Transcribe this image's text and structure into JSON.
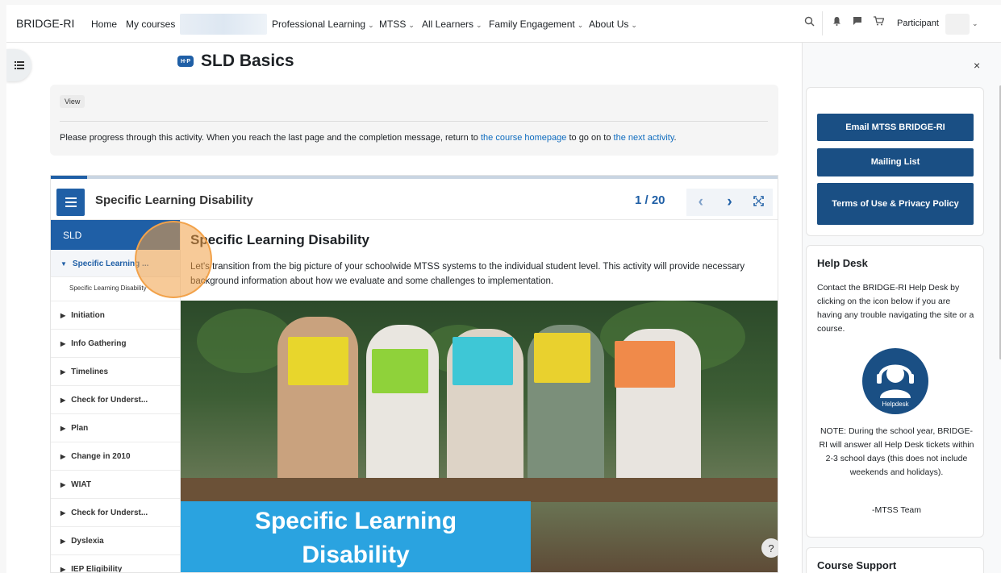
{
  "navbar": {
    "brand": "BRIDGE-RI",
    "links": [
      {
        "label": "Home"
      },
      {
        "label": "My courses"
      },
      {
        "label": "Professional Learning"
      },
      {
        "label": "MTSS"
      },
      {
        "label": "All Learners"
      },
      {
        "label": "Family Engagement"
      },
      {
        "label": "About Us"
      }
    ],
    "user_role": "Participant",
    "icons": [
      "search-icon",
      "bell-icon",
      "chat-icon",
      "cart-icon"
    ]
  },
  "page": {
    "title": "SLD Basics",
    "badge": "H·P",
    "view_label": "View",
    "intro_before": "Please progress through this activity. When you reach the last page and the completion message, return to ",
    "intro_link1": "the course homepage",
    "intro_middle": " to go on to ",
    "intro_link2": "the next activity",
    "intro_after": "."
  },
  "h5p": {
    "chapter_title": "Specific Learning Disability",
    "page_counter": "1 / 20",
    "toc_header": "SLD",
    "toc_active": "Specific Learning ...",
    "toc_sub": "Specific Learning Disability",
    "toc_items": [
      "Initiation",
      "Info Gathering",
      "Timelines",
      "Check for Underst...",
      "Plan",
      "Change in 2010",
      "WIAT",
      "Check for Underst...",
      "Dyslexia",
      "IEP Eligibility"
    ],
    "content_heading": "Specific Learning Disability",
    "content_text": "Let's transition from the big picture of your schoolwide MTSS systems to the individual student level. This activity will provide necessary background information about how we evaluate and some challenges to implementation.",
    "banner_line1": "Specific Learning",
    "banner_line2": "Disability",
    "help_label": "?"
  },
  "drawer": {
    "close_label": "×",
    "buttons": [
      "Email MTSS BRIDGE-RI",
      "Mailing List",
      "Terms of Use & Privacy Policy"
    ],
    "helpdesk_title": "Help Desk",
    "helpdesk_text": "Contact the BRIDGE-RI Help Desk by clicking on the icon below if you are having any trouble navigating the site or a course.",
    "helpdesk_icon_label": "Helpdesk",
    "note_text": "NOTE: During the school year, BRIDGE-RI will answer all Help Desk tickets within 2-3 school days (this does not include weekends and holidays).",
    "signature": "-MTSS Team",
    "course_support_title": "Course Support"
  },
  "colors": {
    "accent": "#1f5fa6",
    "drawer_button": "#1a4f84",
    "link": "#0f6cbf",
    "banner": "#2aa3e0",
    "click_indicator": "#f2a24a"
  }
}
